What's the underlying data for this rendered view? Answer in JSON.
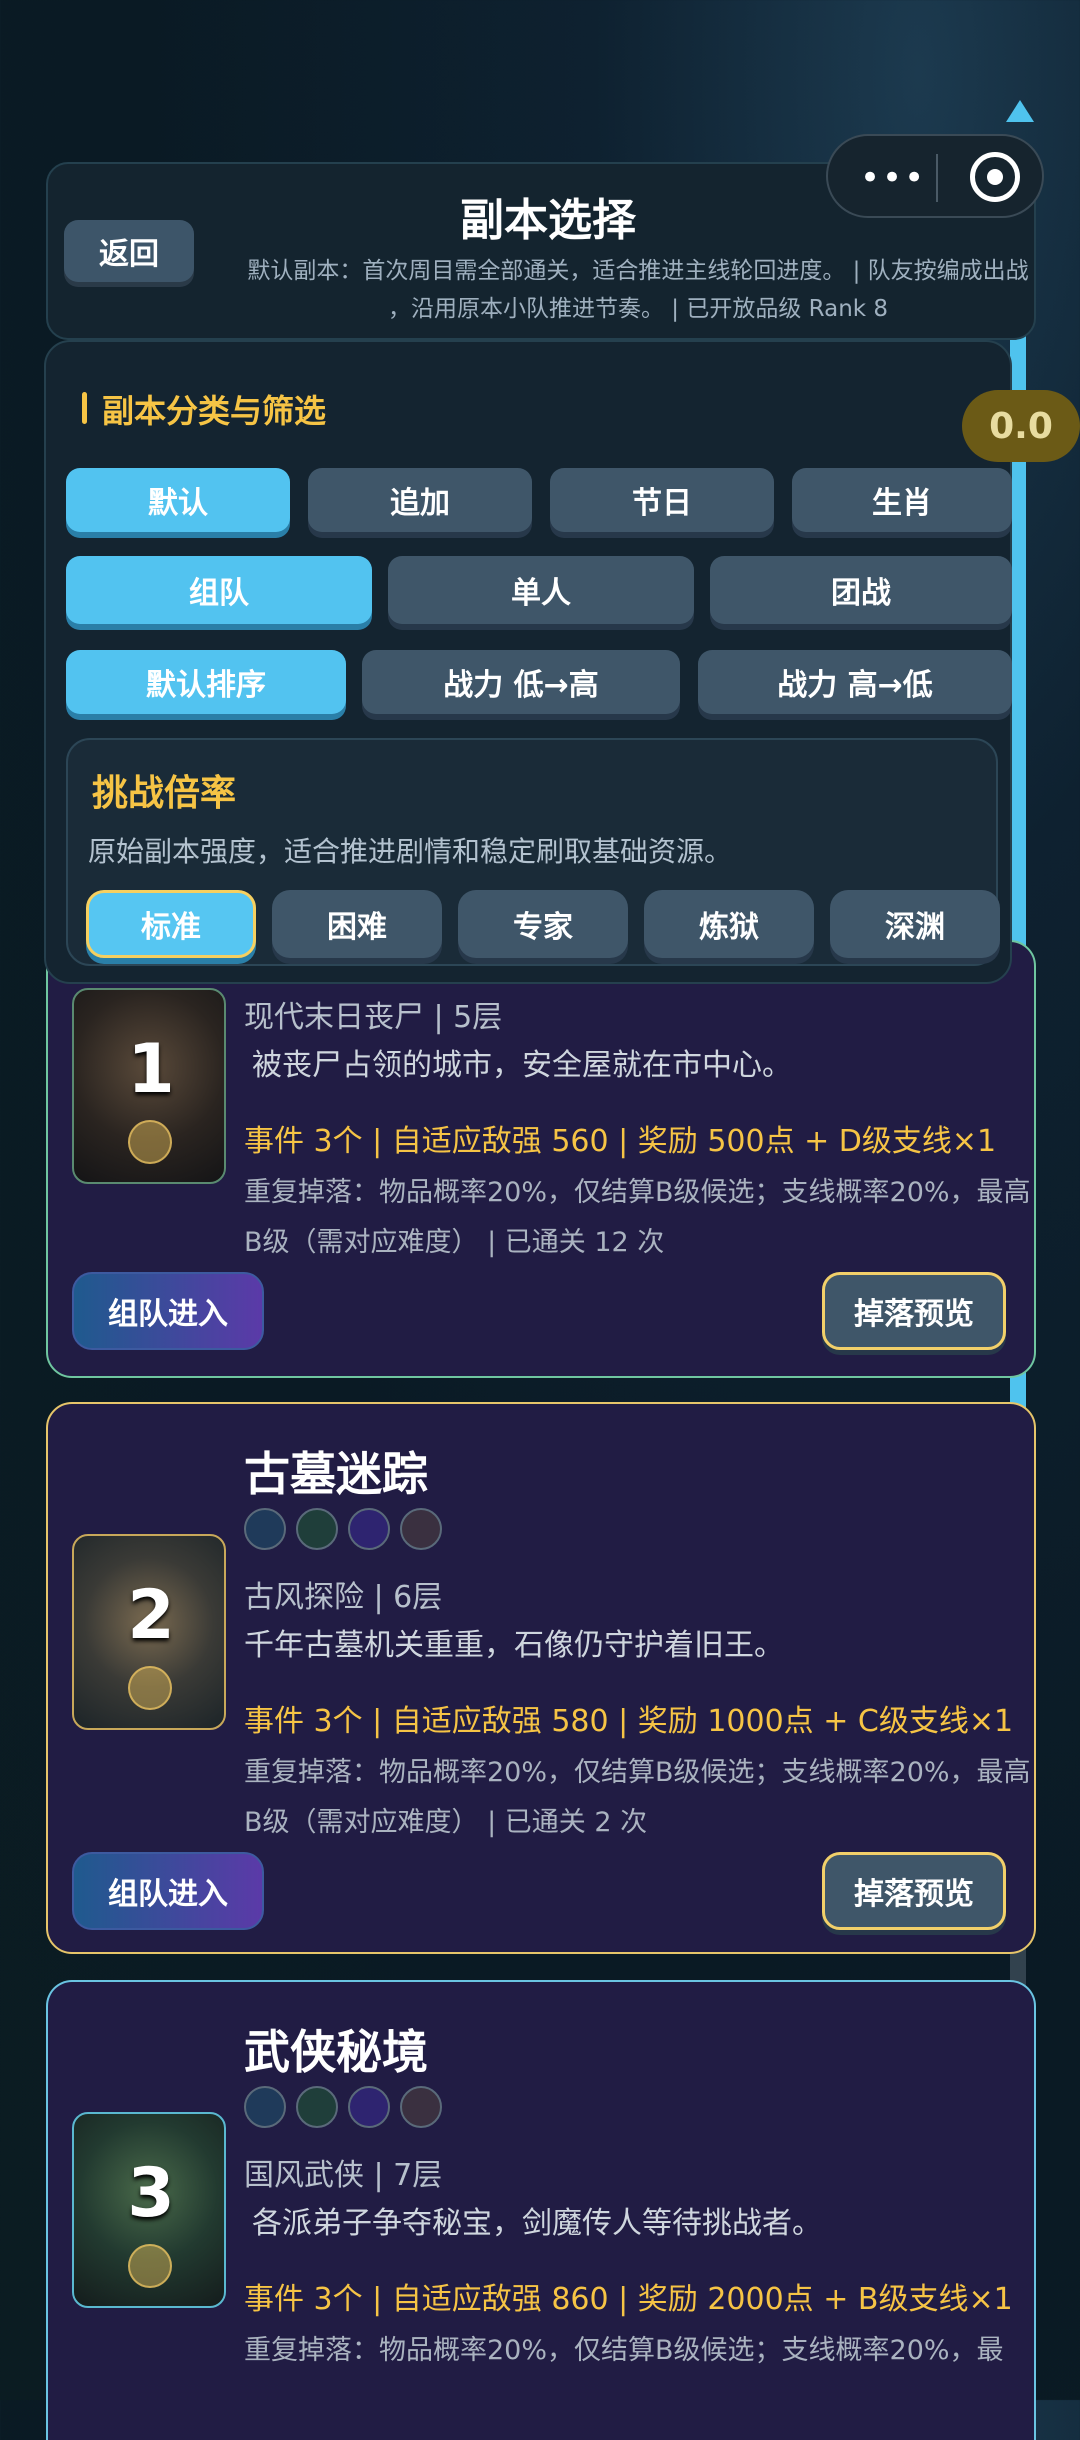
{
  "header": {
    "back_label": "返回",
    "title": "副本选择",
    "subtitle_line1": "默认副本：首次周目需全部通关，适合推进主线轮回进度。 | 队友按编成出战",
    "subtitle_line2": "，沿用原本小队推进节奏。 | 已开放品级 Rank 8"
  },
  "score_badge": "0.0",
  "capsule": {
    "menu_icon": "more-dots-icon",
    "close_icon": "target-icon"
  },
  "filter": {
    "title": "副本分类与筛选",
    "categories": [
      "默认",
      "追加",
      "节日",
      "生肖"
    ],
    "modes": [
      "组队",
      "单人",
      "团战"
    ],
    "sorts": [
      "默认排序",
      "战力 低→高",
      "战力 高→低"
    ],
    "rate": {
      "title": "挑战倍率",
      "desc": "原始副本强度，适合推进剧情和稳定刷取基础资源。",
      "options": [
        "标准",
        "困难",
        "专家",
        "炼狱",
        "深渊"
      ]
    }
  },
  "cards": [
    {
      "num": "1",
      "meta": "现代末日丧尸 | 5层",
      "desc": "被丧尸占领的城市，安全屋就在市中心。",
      "event": "事件 3个 | 自适应敌强 560 | 奖励 500点 + D级支线×1",
      "drop": "重复掉落：物品概率20%，仅结算B级候选；支线概率20%，最高B级（需对应难度） | 已通关 12 次",
      "enter": "组队进入",
      "preview": "掉落预览"
    },
    {
      "num": "2",
      "title": "古墓迷踪",
      "meta": "古风探险 | 6层",
      "desc": "千年古墓机关重重，石像仍守护着旧王。",
      "event": "事件 3个 | 自适应敌强 580 | 奖励 1000点 + C级支线×1",
      "drop": "重复掉落：物品概率20%，仅结算B级候选；支线概率20%，最高B级（需对应难度） | 已通关 2 次",
      "enter": "组队进入",
      "preview": "掉落预览"
    },
    {
      "num": "3",
      "title": "武侠秘境",
      "meta": "国风武侠 | 7层",
      "desc": "各派弟子争夺秘宝，剑魔传人等待挑战者。",
      "event": "事件 3个 | 自适应敌强 860 | 奖励 2000点 + B级支线×1",
      "drop": "重复掉落：物品概率20%，仅结算B级候选；支线概率20%，最"
    }
  ]
}
